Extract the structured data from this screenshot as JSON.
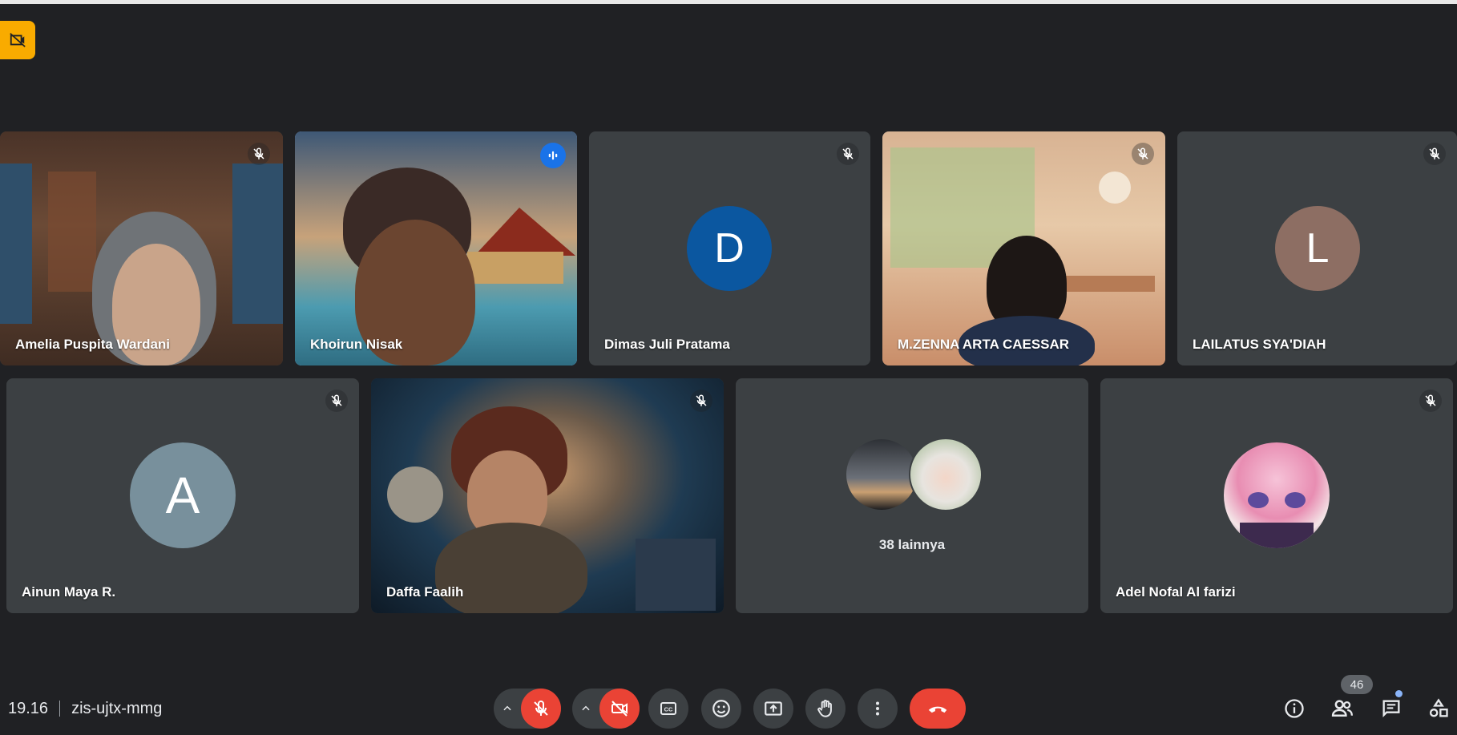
{
  "meeting": {
    "time": "19.16",
    "code": "zis-ujtx-mmg",
    "participants_count": "46"
  },
  "tiles": [
    {
      "name": "Amelia Puspita Wardani",
      "type": "video",
      "muted": true
    },
    {
      "name": "Khoirun Nisak",
      "type": "video",
      "speaking": true
    },
    {
      "name": "Dimas Juli Pratama",
      "type": "letter",
      "letter": "D",
      "avatar_color": "#0b57a0",
      "muted": true
    },
    {
      "name": "M.ZENNA ARTA CAESSAR",
      "type": "video",
      "muted": true
    },
    {
      "name": "LAILATUS SYA'DIAH",
      "type": "letter",
      "letter": "L",
      "avatar_color": "#8d6e63",
      "muted": true
    },
    {
      "name": "Ainun Maya R.",
      "type": "letter",
      "letter": "A",
      "avatar_color": "#78909c",
      "muted": true
    },
    {
      "name": "Daffa Faalih",
      "type": "video",
      "muted": true
    },
    {
      "name": "",
      "type": "others",
      "label": "38 lainnya"
    },
    {
      "name": "Adel Nofal Al farizi",
      "type": "image-avatar",
      "muted": true
    }
  ],
  "colors": {
    "background": "#202124",
    "tile": "#3c4043",
    "end_call": "#ea4335",
    "active_border": "#8ab4f8",
    "recording_badge": "#f9ab00"
  },
  "icons": {
    "recording": "no-camera-recording-icon",
    "mic_off": "mic-off-icon",
    "camera_off": "camera-off-icon",
    "captions": "captions-icon",
    "emoji": "emoji-icon",
    "present": "present-screen-icon",
    "raise_hand": "raise-hand-icon",
    "more": "more-vert-icon",
    "end_call": "phone-hangup-icon",
    "info": "info-icon",
    "people": "people-icon",
    "chat": "chat-icon",
    "activities": "activities-icon"
  }
}
